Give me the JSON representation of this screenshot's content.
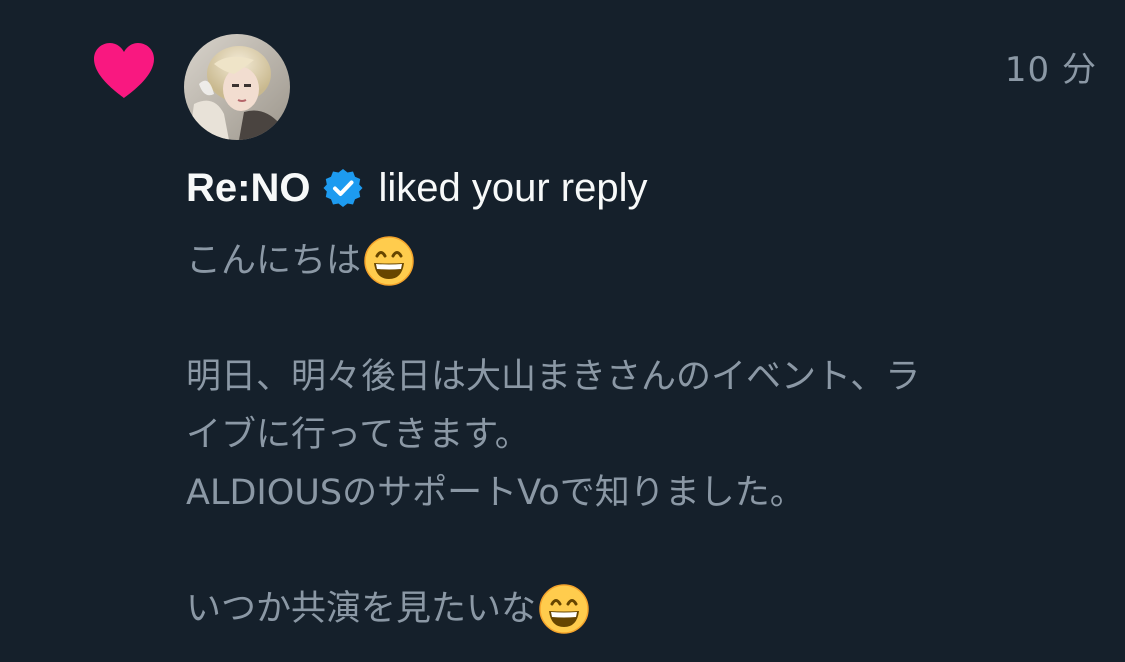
{
  "notification": {
    "icon": "heart-icon",
    "icon_color": "#f91880",
    "timestamp": "10 分",
    "user_name": "Re:NO",
    "verified": true,
    "verified_color": "#1d9bf0",
    "action_text": "liked your reply",
    "reply_lines": [
      {
        "text": "こんにちは",
        "emoji": "grinning-face-emoji"
      },
      {
        "text": ""
      },
      {
        "text": "明日、明々後日は大山まきさんのイベント、ラ"
      },
      {
        "text": "イブに行ってきます。"
      },
      {
        "text": "ALDIOUSのサポートVoで知りました。"
      },
      {
        "text": ""
      },
      {
        "text": "いつか共演を見たいな",
        "emoji": "grinning-face-emoji"
      }
    ]
  },
  "colors": {
    "background": "#15202b",
    "primary_text": "#f7f9f9",
    "secondary_text": "#8b98a5"
  }
}
